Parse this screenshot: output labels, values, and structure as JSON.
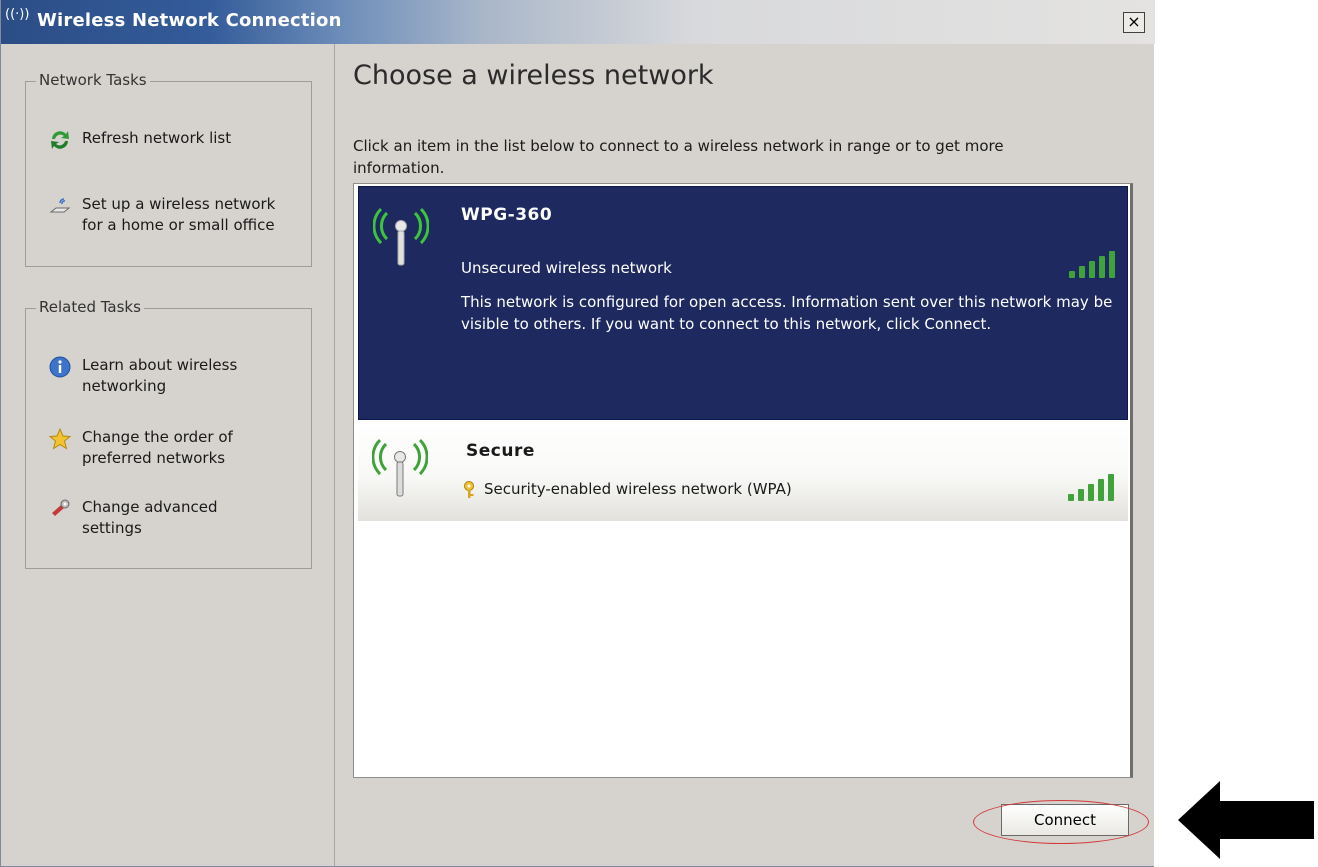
{
  "window": {
    "title": "Wireless Network Connection",
    "close_label": "×"
  },
  "sidebar": {
    "network_tasks": {
      "heading": "Network Tasks",
      "items": [
        {
          "label": "Refresh network list",
          "icon": "refresh-icon"
        },
        {
          "label": "Set up a wireless network for a home or small office",
          "icon": "setup-network-icon"
        }
      ]
    },
    "related_tasks": {
      "heading": "Related Tasks",
      "items": [
        {
          "label": "Learn about wireless networking",
          "icon": "info-icon"
        },
        {
          "label": "Change the order of preferred networks",
          "icon": "star-icon"
        },
        {
          "label": "Change advanced settings",
          "icon": "settings-icon"
        }
      ]
    }
  },
  "main": {
    "title": "Choose a wireless network",
    "description": "Click an item in the list below to connect to a wireless network in range or to get more information.",
    "networks": [
      {
        "name": "WPG-360",
        "status": "Unsecured wireless network",
        "info": "This network is configured for open access. Information sent over this network may be visible to others. If you want to connect to this network, click Connect.",
        "signal_bars": 5,
        "selected": true
      },
      {
        "name": "Secure",
        "status": "Security-enabled wireless network (WPA)",
        "signal_bars": 5,
        "selected": false
      }
    ],
    "connect_label": "Connect"
  },
  "colors": {
    "selected_bg": "#1e2a5f",
    "signal_green": "#3fa23a",
    "highlight_ring": "#d23a3a"
  }
}
